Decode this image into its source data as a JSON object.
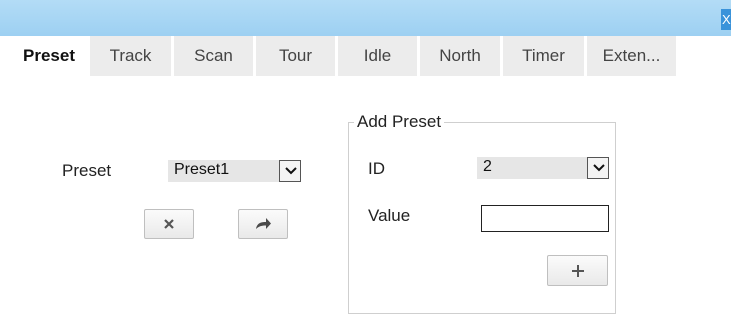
{
  "window": {
    "close_label": "X"
  },
  "tabs": [
    {
      "label": "Preset",
      "active": true
    },
    {
      "label": "Track"
    },
    {
      "label": "Scan"
    },
    {
      "label": "Tour"
    },
    {
      "label": "Idle"
    },
    {
      "label": "North"
    },
    {
      "label": "Timer"
    },
    {
      "label": "Exten..."
    }
  ],
  "preset": {
    "label": "Preset",
    "selected": "Preset1",
    "delete_icon": "close-icon",
    "goto_icon": "arrow-right-icon"
  },
  "add_preset": {
    "legend": "Add Preset",
    "id_label": "ID",
    "id_value": "2",
    "value_label": "Value",
    "value_input": "",
    "add_icon": "plus-icon"
  }
}
